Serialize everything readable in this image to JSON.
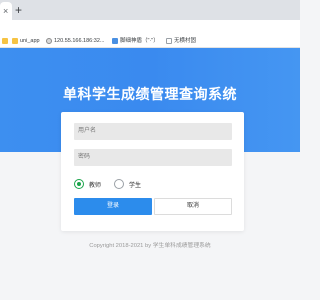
{
  "browser": {
    "new_tab_glyph": "+",
    "close_glyph": "×",
    "bookmarks": [
      {
        "label": "",
        "icon": "folder-icon"
      },
      {
        "label": "uni_app",
        "icon": "folder-icon"
      },
      {
        "label": "120.55.166.186:32...",
        "icon": "globe-icon"
      },
      {
        "label": "脚细神盾（\"·\"）",
        "icon": "app-icon"
      },
      {
        "label": "无横村固",
        "icon": "file-icon"
      }
    ]
  },
  "page": {
    "title": "单科学生成绩管理查询系统",
    "username_placeholder": "用户名",
    "password_placeholder": "密码",
    "roles": [
      {
        "label": "教师",
        "checked": true
      },
      {
        "label": "学生",
        "checked": false
      }
    ],
    "login_label": "登录",
    "cancel_label": "取消",
    "footer": "Copyright 2018-2021 by 学生单科成绩管理系统"
  },
  "colors": {
    "banner": "#3d8ff0",
    "primary_button": "#2c8cec",
    "radio_selected": "#1aa34a"
  }
}
